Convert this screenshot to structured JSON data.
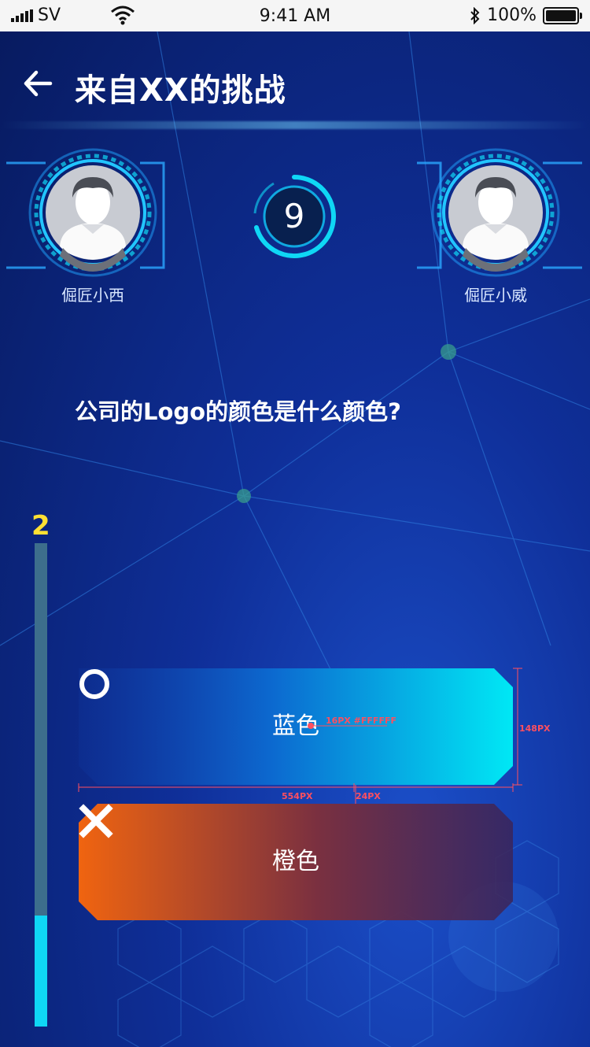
{
  "status_bar": {
    "carrier": "SV",
    "time": "9:41 AM",
    "battery": "100%"
  },
  "header": {
    "title": "来自XX的挑战"
  },
  "players": [
    {
      "name": "倔匠小西"
    },
    {
      "name": "倔匠小威"
    }
  ],
  "timer": {
    "seconds": "9"
  },
  "question": {
    "text": "公司的Logo的颜色是什么颜色?"
  },
  "progress": {
    "count": "2",
    "fill_fraction": 0.23
  },
  "options": [
    {
      "label": "蓝色",
      "state": "selected"
    },
    {
      "label": "橙色",
      "state": "wrong"
    }
  ],
  "annotations": {
    "font_spec": "16PX #FFFFFF",
    "height": "148PX",
    "width": "554PX",
    "corner": "24PX"
  },
  "colors": {
    "accent_cyan": "#0fd7f5",
    "progress_number": "#ffe033",
    "wrong_orange": "#f06410",
    "annotation_red": "#ff4f5f"
  }
}
